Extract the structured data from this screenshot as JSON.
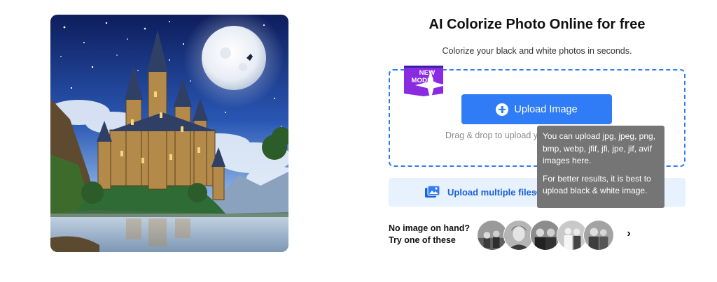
{
  "header": {
    "title": "AI Colorize Photo Online for free",
    "subtitle": "Colorize your black and white photos in seconds."
  },
  "hero": {
    "icon": "castle-painting-image"
  },
  "upload": {
    "badge_line1": "NEW",
    "badge_line2": "MODEL",
    "button_label": "Upload Image",
    "drag_text": "Drag & drop to upload y",
    "accent_color": "#2f7cf6",
    "badge_color": "#8a2be2"
  },
  "multi_upload": {
    "label": "Upload multiple files",
    "arrow": "→",
    "icon": "images-upload-icon"
  },
  "tooltip": {
    "line1": "You can upload jpg, jpeg, png, bmp, webp, jfif, jfi, jpe, jif, avif images here.",
    "line2": "For better results, it is best to upload black & white image."
  },
  "samples": {
    "prompt_line1": "No image on hand?",
    "prompt_line2": "Try one of these",
    "next_label": "›",
    "thumbnails": [
      "sample-photo-1",
      "sample-photo-2",
      "sample-photo-3",
      "sample-photo-4",
      "sample-photo-5"
    ]
  }
}
